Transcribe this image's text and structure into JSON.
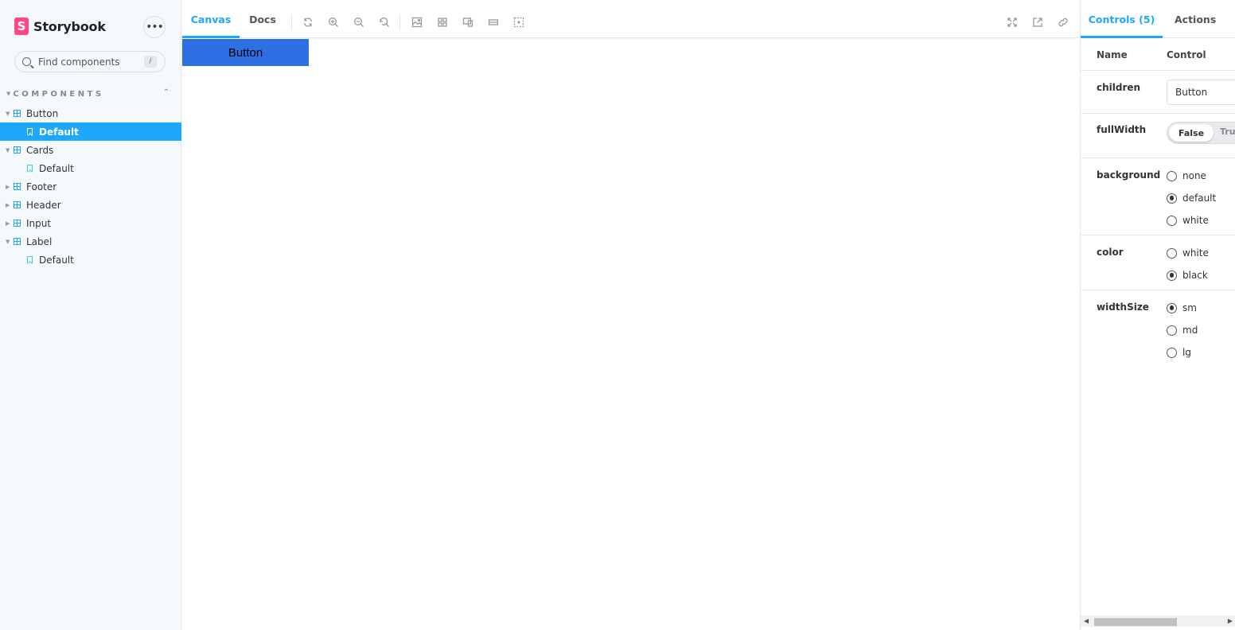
{
  "sidebar": {
    "brand_letter": "S",
    "brand_name": "Storybook",
    "menu_label": "•••",
    "search_placeholder": "Find components",
    "search_shortcut": "/",
    "section_title": "COMPONENTS",
    "items": [
      {
        "label": "Button",
        "type": "group",
        "expanded": true
      },
      {
        "label": "Default",
        "type": "story",
        "selected": true
      },
      {
        "label": "Cards",
        "type": "group",
        "expanded": true
      },
      {
        "label": "Default",
        "type": "story"
      },
      {
        "label": "Footer",
        "type": "group",
        "expanded": false
      },
      {
        "label": "Header",
        "type": "group",
        "expanded": false
      },
      {
        "label": "Input",
        "type": "group",
        "expanded": false
      },
      {
        "label": "Label",
        "type": "group",
        "expanded": true
      },
      {
        "label": "Default",
        "type": "story"
      }
    ]
  },
  "toolbar": {
    "tabs": [
      {
        "label": "Canvas",
        "active": true
      },
      {
        "label": "Docs",
        "active": false
      }
    ],
    "icons": [
      "reload-icon",
      "zoom-in-icon",
      "zoom-out-icon",
      "zoom-reset-icon",
      "background-icon",
      "grid-icon",
      "viewport-icon",
      "measure-icon",
      "outline-icon",
      "fullscreen-icon",
      "open-new-tab-icon",
      "copy-link-icon"
    ]
  },
  "canvas": {
    "preview_button_label": "Button",
    "preview_button_color": "#2f6fe4"
  },
  "panel": {
    "tabs": [
      {
        "label": "Controls (5)",
        "active": true
      },
      {
        "label": "Actions",
        "active": false
      }
    ],
    "head_name": "Name",
    "head_control": "Control",
    "controls": {
      "children": {
        "name": "children",
        "value": "Button"
      },
      "fullWidth": {
        "name": "fullWidth",
        "false_label": "False",
        "true_label": "True",
        "value": false
      },
      "background": {
        "name": "background",
        "options": [
          "none",
          "default",
          "white"
        ],
        "selected": "default"
      },
      "color": {
        "name": "color",
        "options": [
          "white",
          "black"
        ],
        "selected": "black"
      },
      "widthSize": {
        "name": "widthSize",
        "options": [
          "sm",
          "md",
          "lg"
        ],
        "selected": "sm"
      }
    }
  },
  "colors": {
    "accent": "#1ea7fd",
    "brand": "#ff4785"
  }
}
